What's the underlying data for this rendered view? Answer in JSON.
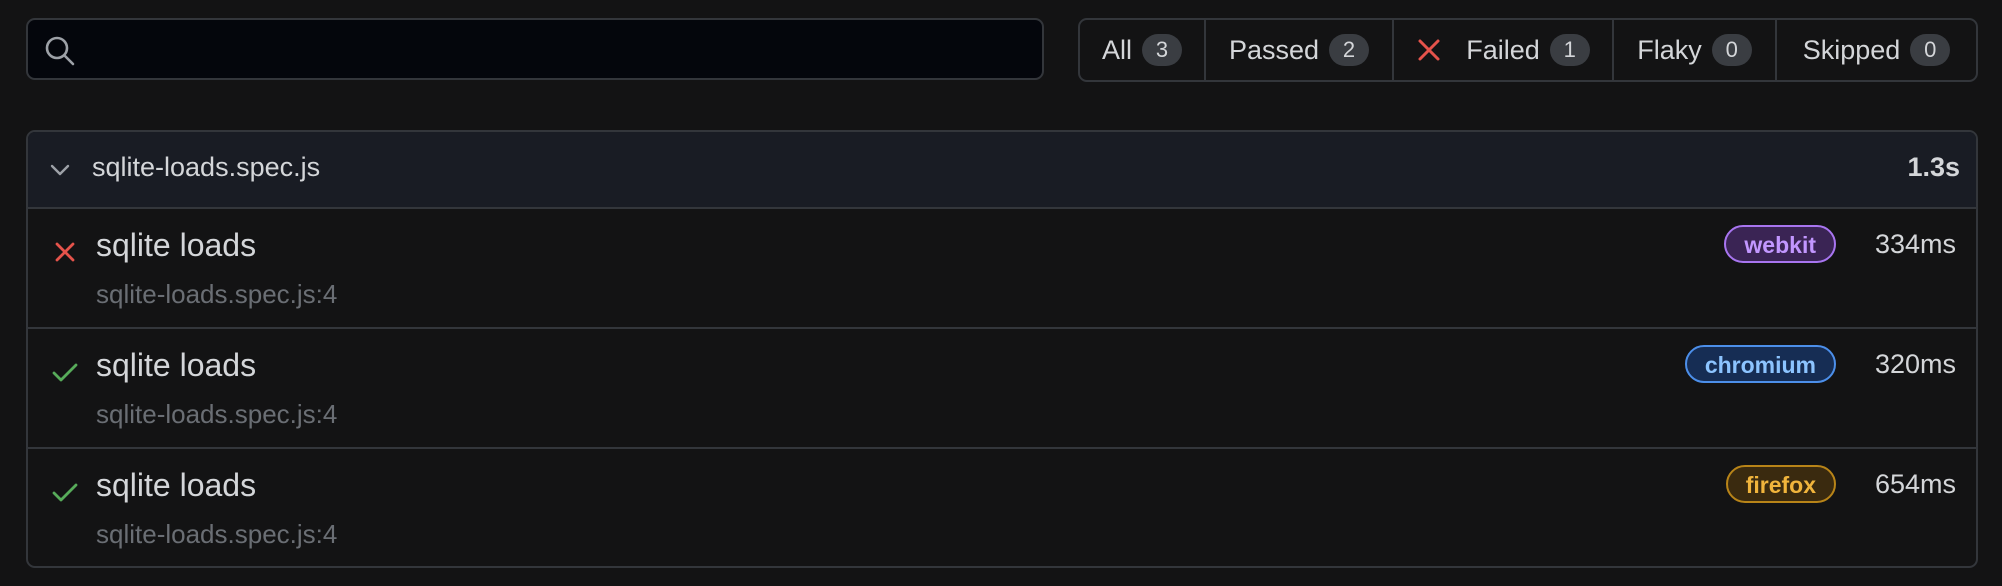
{
  "search": {
    "value": "",
    "placeholder": ""
  },
  "filters": [
    {
      "label": "All",
      "count": "3"
    },
    {
      "label": "Passed",
      "count": "2"
    },
    {
      "label": "Failed",
      "count": "1"
    },
    {
      "label": "Flaky",
      "count": "0"
    },
    {
      "label": "Skipped",
      "count": "0"
    }
  ],
  "file": {
    "name": "sqlite-loads.spec.js",
    "duration": "1.3s"
  },
  "tests": [
    {
      "status": "failed",
      "title": "sqlite loads",
      "location": "sqlite-loads.spec.js:4",
      "project": "webkit",
      "duration": "334ms"
    },
    {
      "status": "passed",
      "title": "sqlite loads",
      "location": "sqlite-loads.spec.js:4",
      "project": "chromium",
      "duration": "320ms"
    },
    {
      "status": "passed",
      "title": "sqlite loads",
      "location": "sqlite-loads.spec.js:4",
      "project": "firefox",
      "duration": "654ms"
    }
  ],
  "colors": {
    "failed": "#e5534b",
    "passed": "#57ab5a",
    "webkit": "#c297ff",
    "chromium": "#8cc4ff",
    "firefox": "#f0b43c"
  },
  "icons": {
    "search": "search-icon",
    "chevron": "chevron-down-icon",
    "failed": "x-icon",
    "passed": "check-icon"
  }
}
